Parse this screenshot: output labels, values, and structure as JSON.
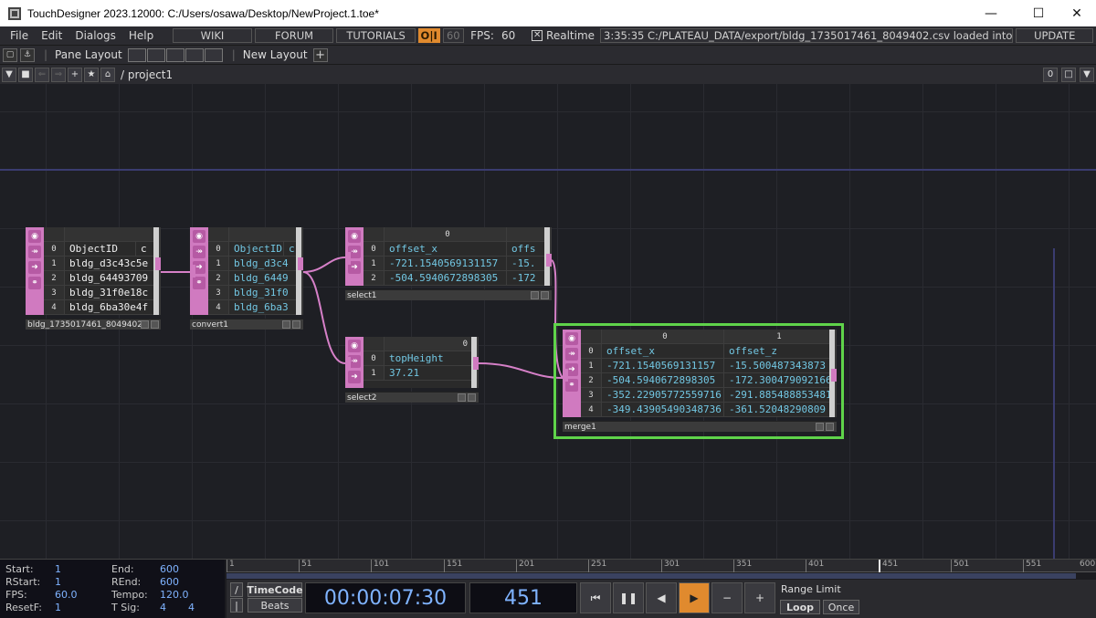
{
  "window": {
    "title": "TouchDesigner 2023.12000: C:/Users/osawa/Desktop/NewProject.1.toe*"
  },
  "menu": {
    "items": [
      "File",
      "Edit",
      "Dialogs",
      "Help"
    ]
  },
  "topbar": {
    "wiki": "WIKI",
    "forum": "FORUM",
    "tutorials": "TUTORIALS",
    "oi": "O|I",
    "fps_box": "60",
    "fps_label": "FPS:",
    "fps_value": "60",
    "realtime": "Realtime",
    "status": "3:35:35 C:/PLATEAU_DATA/export/bldg_1735017461_8049402.csv loaded into DAT /",
    "update": "UPDATE"
  },
  "toolbar": {
    "pane_layout": "Pane Layout",
    "new_layout": "New Layout"
  },
  "path": {
    "text": "/ project1",
    "counter": "0"
  },
  "nodes": {
    "source": {
      "label": "bldg_1735017461_8049402",
      "rows": [
        [
          "0",
          "ObjectID",
          "c"
        ],
        [
          "1",
          "bldg_d3c43c5e",
          ""
        ],
        [
          "2",
          "bldg_64493709",
          ""
        ],
        [
          "3",
          "bldg_31f0e18c",
          ""
        ],
        [
          "4",
          "bldg_6ba30e4f",
          ""
        ]
      ]
    },
    "convert": {
      "label": "convert1",
      "rows": [
        [
          "0",
          "ObjectID",
          "c"
        ],
        [
          "1",
          "bldg_d3c4",
          ""
        ],
        [
          "2",
          "bldg_6449",
          ""
        ],
        [
          "3",
          "bldg_31f0",
          ""
        ],
        [
          "4",
          "bldg_6ba3",
          ""
        ]
      ]
    },
    "select1": {
      "label": "select1",
      "col0": "0",
      "rows": [
        [
          "0",
          "offset_x",
          "offs"
        ],
        [
          "1",
          "-721.1540569131157",
          "-15."
        ],
        [
          "2",
          "-504.5940672898305",
          "-172"
        ]
      ]
    },
    "select2": {
      "label": "select2",
      "col0": "0",
      "rows": [
        [
          "0",
          "topHeight"
        ],
        [
          "1",
          "37.21"
        ]
      ]
    },
    "merge": {
      "label": "merge1",
      "col0": "0",
      "col1": "1",
      "rows": [
        [
          "0",
          "offset_x",
          "offset_z"
        ],
        [
          "1",
          "-721.1540569131157",
          "-15.500487343873"
        ],
        [
          "2",
          "-504.5940672898305",
          "-172.300479092166"
        ],
        [
          "3",
          "-352.22905772559716",
          "-291.885488853481"
        ],
        [
          "4",
          "-349.43905490348736",
          "-361.52048290809"
        ]
      ]
    }
  },
  "timeline": {
    "start_label": "Start:",
    "start": "1",
    "end_label": "End:",
    "end": "600",
    "rstart_label": "RStart:",
    "rstart": "1",
    "rend_label": "REnd:",
    "rend": "600",
    "fps_label": "FPS:",
    "fps": "60.0",
    "tempo_label": "Tempo:",
    "tempo": "120.0",
    "resetf_label": "ResetF:",
    "resetf": "1",
    "tsig_label": "T Sig:",
    "tsig_a": "4",
    "tsig_b": "4",
    "ticks": [
      "1",
      "51",
      "101",
      "151",
      "201",
      "251",
      "301",
      "351",
      "401",
      "451",
      "501",
      "551",
      "600"
    ],
    "timecode": "TimeCode",
    "beats": "Beats",
    "time": "00:00:07:30",
    "frame": "451",
    "range_limit": "Range Limit",
    "loop": "Loop",
    "once": "Once"
  }
}
